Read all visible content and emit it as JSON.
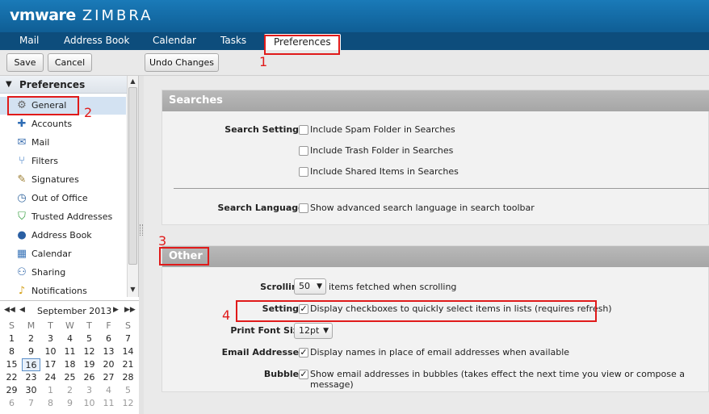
{
  "app": {
    "brand_vm": "vmware",
    "brand_zimbra": "ZIMBRA"
  },
  "nav": {
    "tabs": [
      {
        "label": "Mail"
      },
      {
        "label": "Address Book"
      },
      {
        "label": "Calendar"
      },
      {
        "label": "Tasks"
      },
      {
        "label": "Preferences"
      }
    ]
  },
  "toolbar": {
    "save_label": "Save",
    "cancel_label": "Cancel",
    "undo_label": "Undo Changes"
  },
  "tree": {
    "header": "Preferences",
    "items": [
      {
        "label": "General",
        "icon": "gear-icon"
      },
      {
        "label": "Accounts",
        "icon": "accounts-icon"
      },
      {
        "label": "Mail",
        "icon": "mail-icon"
      },
      {
        "label": "Filters",
        "icon": "filter-icon"
      },
      {
        "label": "Signatures",
        "icon": "signature-icon"
      },
      {
        "label": "Out of Office",
        "icon": "clock-icon"
      },
      {
        "label": "Trusted Addresses",
        "icon": "shield-icon"
      },
      {
        "label": "Address Book",
        "icon": "contact-icon"
      },
      {
        "label": "Calendar",
        "icon": "calendar-icon"
      },
      {
        "label": "Sharing",
        "icon": "share-icon"
      },
      {
        "label": "Notifications",
        "icon": "bell-icon"
      }
    ]
  },
  "calendar": {
    "title": "September 2013",
    "dow": [
      "S",
      "M",
      "T",
      "W",
      "T",
      "F",
      "S"
    ],
    "weeks": [
      [
        "1",
        "2",
        "3",
        "4",
        "5",
        "6",
        "7"
      ],
      [
        "8",
        "9",
        "10",
        "11",
        "12",
        "13",
        "14"
      ],
      [
        "15",
        "16",
        "17",
        "18",
        "19",
        "20",
        "21"
      ],
      [
        "22",
        "23",
        "24",
        "25",
        "26",
        "27",
        "28"
      ],
      [
        "29",
        "30",
        "1",
        "2",
        "3",
        "4",
        "5"
      ],
      [
        "6",
        "7",
        "8",
        "9",
        "10",
        "11",
        "12"
      ]
    ],
    "today": "16"
  },
  "searches": {
    "title": "Searches",
    "search_settings_label": "Search Settings:",
    "opt_spam": "Include Spam Folder in Searches",
    "opt_trash": "Include Trash Folder in Searches",
    "opt_shared": "Include Shared Items in Searches",
    "search_language_label": "Search Language:",
    "opt_advanced": "Show advanced search language in search toolbar"
  },
  "other": {
    "title": "Other",
    "scrolling_label": "Scrolling:",
    "scrolling_value": "50",
    "scrolling_suffix": "items fetched when scrolling",
    "settings_label": "Settings:",
    "opt_checkboxes": "Display checkboxes to quickly select items in lists (requires refresh)",
    "print_font_label": "Print Font Size:",
    "print_font_value": "12pt",
    "email_addresses_label": "Email Addresses:",
    "opt_names": "Display names in place of email addresses when available",
    "bubbles_label": "Bubbles:",
    "opt_bubbles": "Show email addresses in bubbles (takes effect the next time you view or compose a message)"
  },
  "annotations": [
    "1",
    "2",
    "3",
    "4"
  ],
  "colors": {
    "accent": "#0f5e95",
    "annotation": "#e01a1a"
  }
}
